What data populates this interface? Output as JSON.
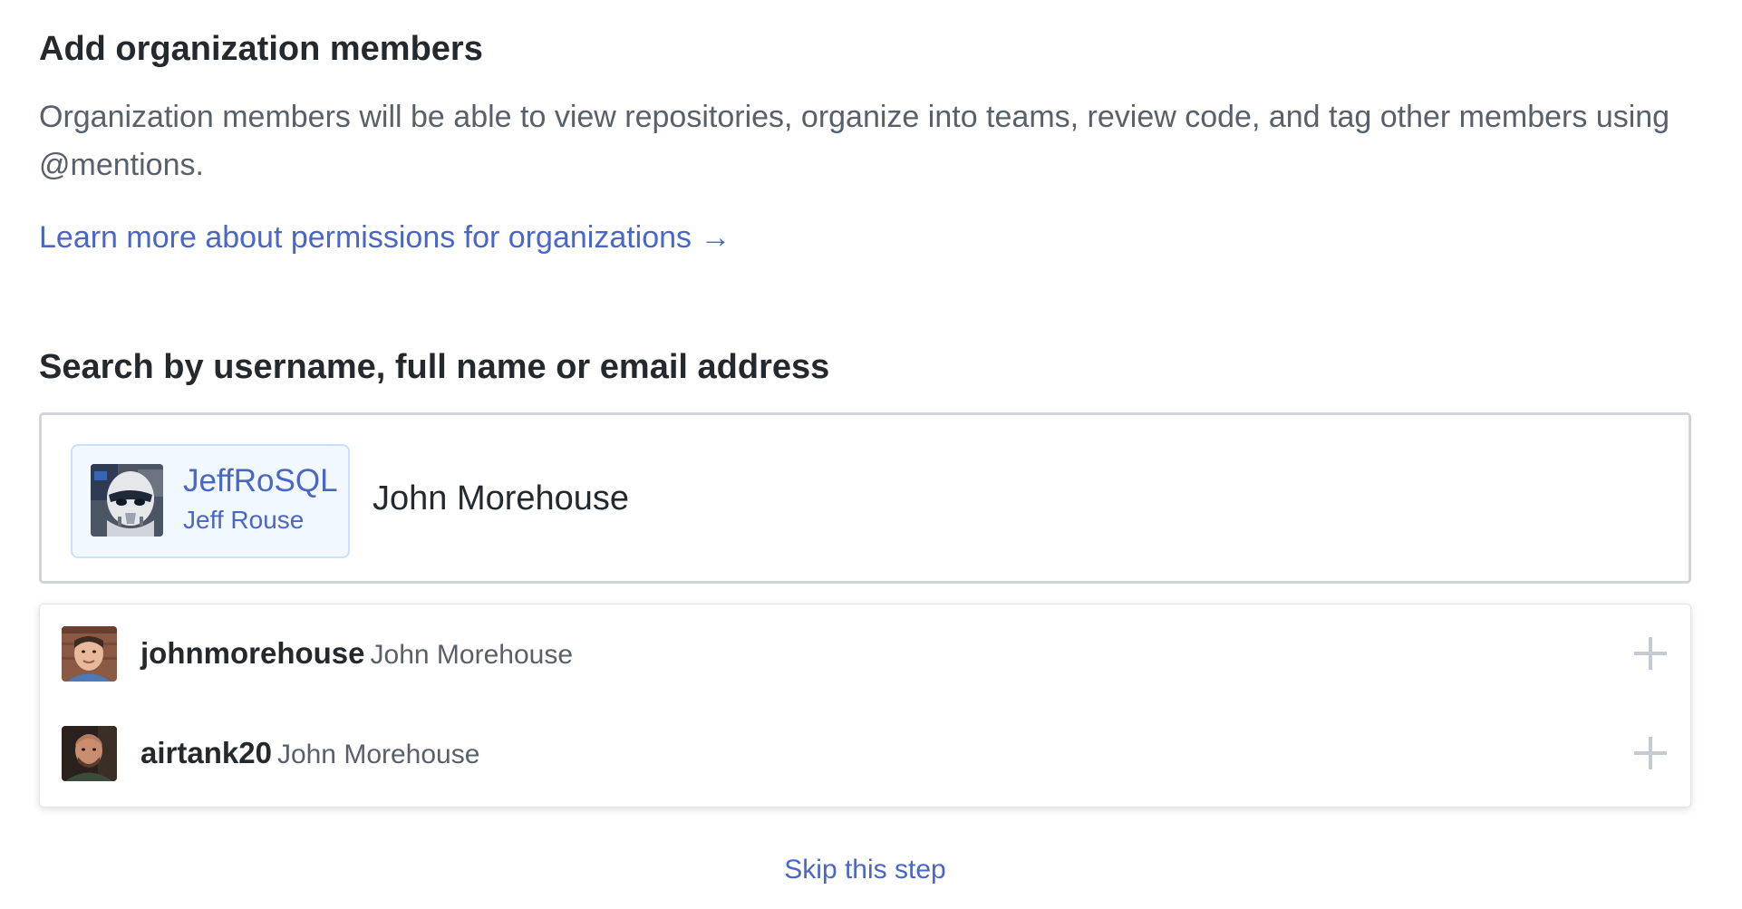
{
  "header": {
    "title": "Add organization members",
    "description": "Organization members will be able to view repositories, organize into teams, review code, and tag other members using @mentions.",
    "learn_more_link": "Learn more about permissions for organizations →"
  },
  "search": {
    "label": "Search by username, full name or email address",
    "query": "John Morehouse",
    "selected": [
      {
        "username": "JeffRoSQL",
        "full_name": "Jeff Rouse",
        "avatar_icon": "stormtrooper-avatar"
      }
    ]
  },
  "results": [
    {
      "username": "johnmorehouse",
      "full_name": "John Morehouse",
      "avatar_icon": "user-photo-avatar",
      "action_icon": "plus-icon"
    },
    {
      "username": "airtank20",
      "full_name": "John Morehouse",
      "avatar_icon": "user-photo-avatar",
      "action_icon": "plus-icon"
    }
  ],
  "footer": {
    "skip_label": "Skip this step"
  },
  "colors": {
    "link": "#4a66c6",
    "text": "#24292e",
    "muted": "#586069",
    "chip_bg": "#f1f8ff",
    "chip_border": "#c8e1ff",
    "border": "#d1d5da"
  }
}
